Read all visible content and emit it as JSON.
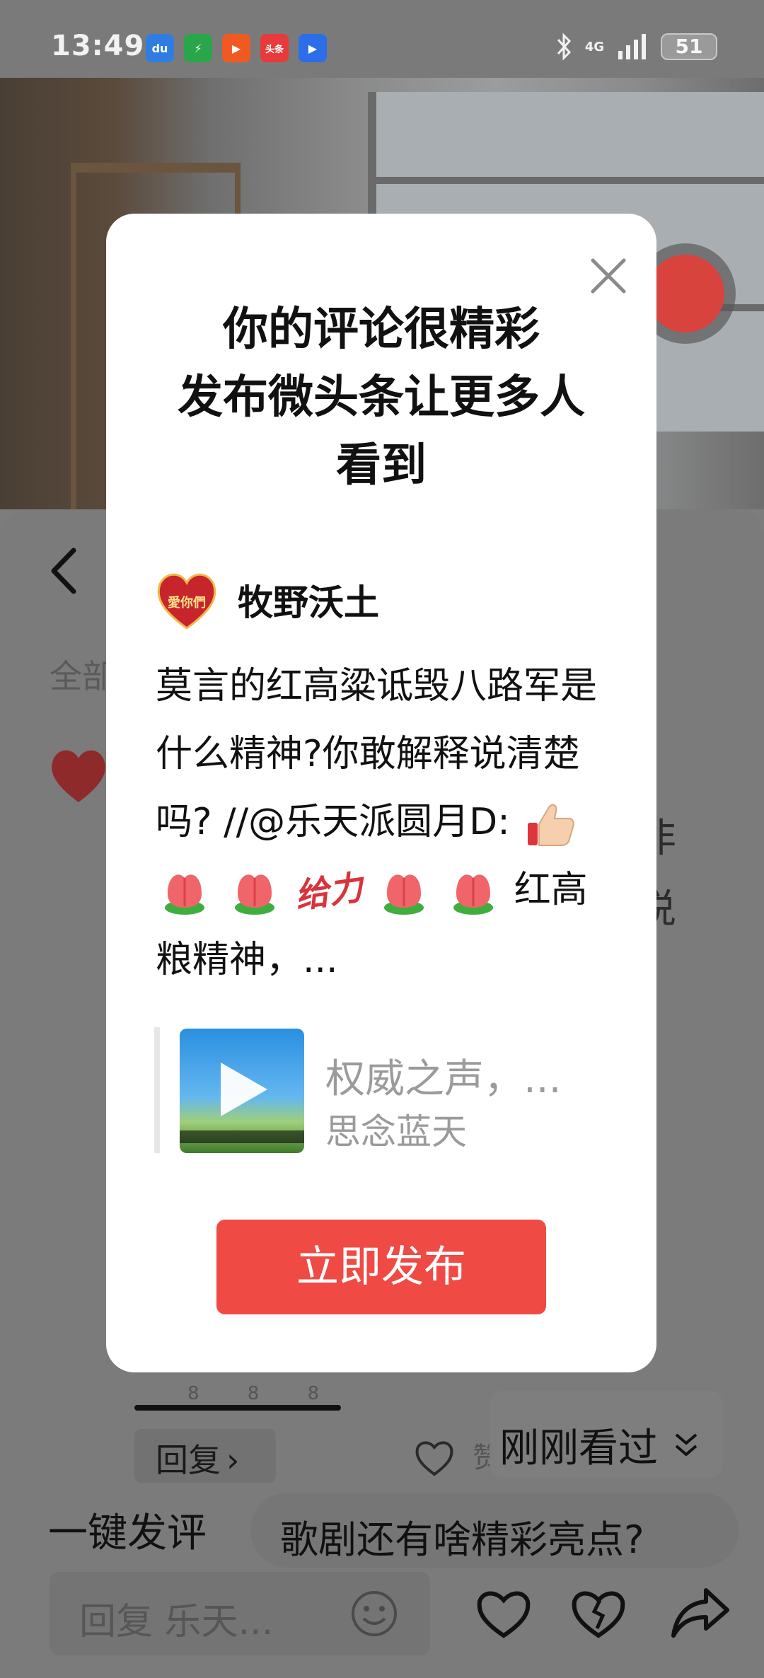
{
  "status_bar": {
    "time": "13:49",
    "network": "4G",
    "battery": "51",
    "apps": [
      {
        "name": "baidu-app-icon",
        "label": "du",
        "color": "#2f7de1"
      },
      {
        "name": "shield-app-icon",
        "label": "⚡",
        "color": "#29a64a"
      },
      {
        "name": "video-app-icon",
        "label": "▶",
        "color": "#f05a22"
      },
      {
        "name": "toutiao-app-icon",
        "label": "头条",
        "color": "#e83a3a"
      },
      {
        "name": "player-app-icon",
        "label": "▶",
        "color": "#2b6ee8"
      }
    ]
  },
  "background": {
    "tab_all": "全部",
    "side_text_1": "非",
    "side_text_2": "说",
    "reply_label": "回复",
    "char_peek": "赞",
    "progress_marks": "8 8 8",
    "recent_label": "刚刚看过",
    "quick_comment_label": "一键发评",
    "suggestion": "歌剧还有啥精彩亮点?",
    "input_placeholder": "回复 乐天..."
  },
  "modal": {
    "title_line1": "你的评论很精彩",
    "title_line2": "发布微头条让更多人",
    "title_line3": "看到",
    "author_name": "牧野沃土",
    "avatar_text": "愛你們",
    "comment_text_1": "莫言的红高粱诋毁八路军是什么精神?你敢解释说清楚吗? //@乐天派圆月D:",
    "comment_sticker": "给力",
    "comment_text_2": "红高粮精神，...",
    "quote_title": "权威之声，...",
    "quote_author": "思念蓝天",
    "publish_label": "立即发布"
  },
  "colors": {
    "accent": "#f04a45",
    "overlay": "#7d7d7d",
    "modal_bg": "#ffffff"
  }
}
